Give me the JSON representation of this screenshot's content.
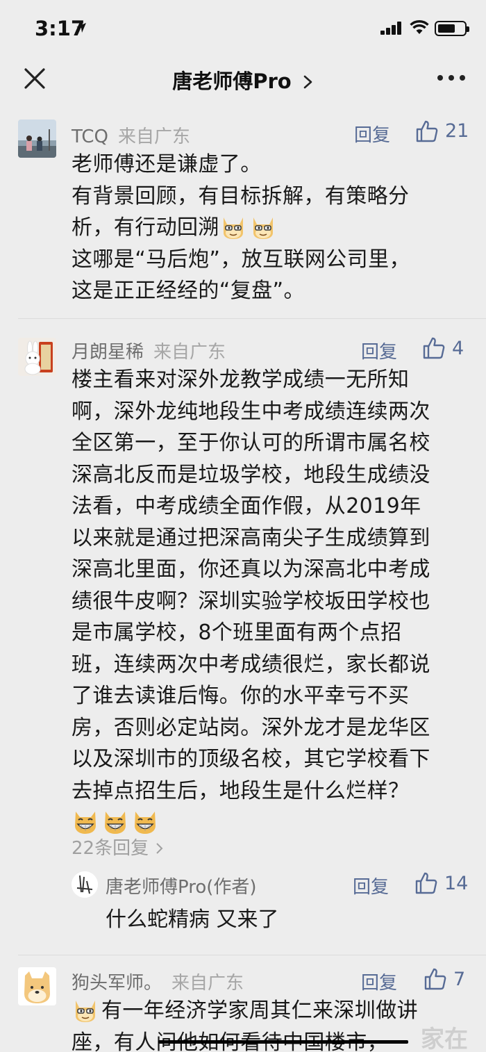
{
  "status": {
    "time": "3:17"
  },
  "nav": {
    "title": "唐老师傅Pro"
  },
  "comments": [
    {
      "name": "TCQ",
      "location": "来自广东",
      "reply_label": "回复",
      "likes": "21",
      "lines": [
        "老师傅还是谦虚了。",
        "有背景回顾，有目标拆解，有策略分",
        "析，有行动回溯",
        "这哪是“马后炮”，放互联网公司里，",
        "这是正正经经的“复盘”。"
      ]
    },
    {
      "name": "月朗星稀",
      "location": "来自广东",
      "reply_label": "回复",
      "likes": "4",
      "lines": [
        "楼主看来对深外龙教学成绩一无所知",
        "啊，深外龙纯地段生中考成绩连续两次",
        "全区第一，至于你认可的所谓市属名校",
        "深高北反而是垃圾学校，地段生成绩没",
        "法看，中考成绩全面作假，从2019年",
        "以来就是通过把深高南尖子生成绩算到",
        "深高北里面，你还真以为深高北中考成",
        "绩很牛皮啊？深圳实验学校坂田学校也",
        "是市属学校，8个班里面有两个点招",
        "班，连续两次中考成绩很烂，家长都说",
        "了谁去读谁后悔。你的水平幸亏不买",
        "房，否则必定站岗。深外龙才是龙华区",
        "以及深圳市的顶级名校，其它学校看下",
        "去掉点招生后，地段生是什么烂样？"
      ],
      "replies_count_label": "22条回复",
      "author_reply": {
        "name": "唐老师傅Pro(作者)",
        "reply_label": "回复",
        "likes": "14",
        "text": "什么蛇精病 又来了"
      }
    },
    {
      "name": "狗头军师。",
      "location": "来自广东",
      "reply_label": "回复",
      "likes": "7",
      "lines": [
        "有一年经济学家周其仁来深圳做讲",
        "座，有人问他如何看待中国楼市，"
      ]
    }
  ],
  "watermark": "家在",
  "colors": {
    "link": "#576b95",
    "background": "#ededed",
    "text": "#191919",
    "meta": "#a6a6a6"
  }
}
